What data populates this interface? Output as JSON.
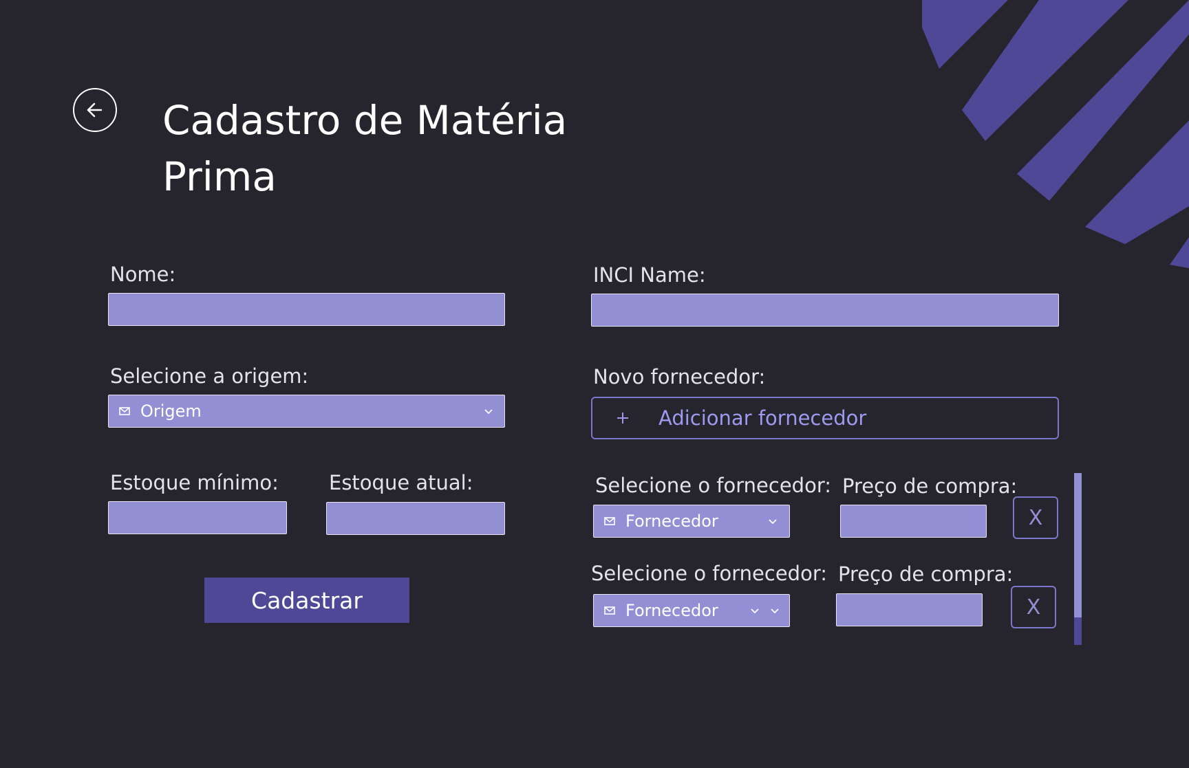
{
  "header": {
    "title_line1": "Cadastro de Matéria",
    "title_line2": "Prima",
    "back_icon": "arrow-left-icon"
  },
  "form_left": {
    "nome_label": "Nome:",
    "origem_label": "Selecione a origem:",
    "origem_value": "Origem",
    "estoque_min_label": "Estoque mínimo:",
    "estoque_atual_label": "Estoque atual:",
    "submit_label": "Cadastrar"
  },
  "form_right": {
    "inci_label": "INCI Name:",
    "novo_fornecedor_label": "Novo fornecedor:",
    "add_fornecedor_label": "Adicionar fornecedor",
    "suppliers": [
      {
        "select_label": "Selecione o fornecedor:",
        "select_value": "Fornecedor",
        "price_label": "Preço de compra:",
        "remove_label": "X"
      },
      {
        "select_label": "Selecione o fornecedor:",
        "select_value": "Fornecedor",
        "price_label": "Preço de compra:",
        "remove_label": "X"
      }
    ]
  },
  "colors": {
    "background": "#26252d",
    "field": "#938fd4",
    "accent": "#4f4896",
    "outline": "#7c76cc"
  }
}
